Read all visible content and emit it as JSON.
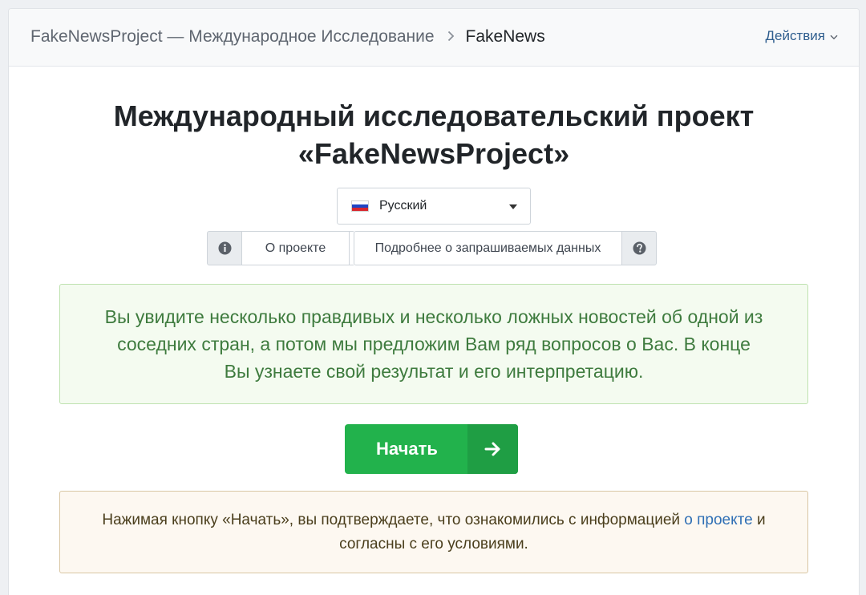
{
  "breadcrumb": {
    "parent": "FakeNewsProject — Международное Исследование",
    "current": "FakeNews"
  },
  "actions_label": "Действия",
  "title": {
    "line1": "Международный исследовательский проект",
    "line2": "«FakeNewsProject»"
  },
  "language": {
    "selected": "Русский",
    "flag_icon": "russia-flag-icon"
  },
  "info_buttons": {
    "about": "О проекте",
    "details": "Подробнее о запрашиваемых данных"
  },
  "intro_text": "Вы увидите несколько правдивых и несколько ложных новостей об одной из соседних стран, а потом мы предложим Вам ряд вопросов о Вас. В конце Вы узнаете свой результат и его интерпретацию.",
  "start_button": {
    "label": "Начать"
  },
  "consent": {
    "before": "Нажимая кнопку «Начать», вы подтверждаете, что ознакомились с информацией ",
    "link": "о проекте",
    "after": " и согласны с его условиями."
  },
  "colors": {
    "start_button": "#22b24c",
    "success_text": "#3e7b3e",
    "link": "#2f6fb5"
  }
}
